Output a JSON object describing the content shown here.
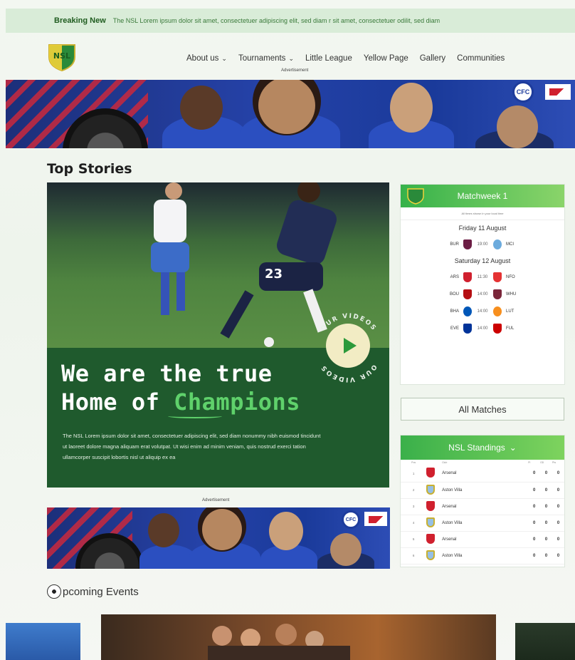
{
  "breaking": {
    "label": "Breaking New",
    "text": "The NSL Lorem ipsum dolor sit amet, consectetuer adipiscing elit, sed diam  r sit amet, consectetuer odilit, sed diam"
  },
  "header": {
    "logo_text": "NSL",
    "nav": [
      {
        "label": "About us",
        "dropdown": true
      },
      {
        "label": "Tournaments",
        "dropdown": true
      },
      {
        "label": "Little League",
        "dropdown": false
      },
      {
        "label": "Yellow Page",
        "dropdown": false
      },
      {
        "label": "Gallery",
        "dropdown": false
      },
      {
        "label": "Communities",
        "dropdown": false
      }
    ],
    "ad_label": "Advertisement"
  },
  "top_stories": {
    "title": "Top Stories",
    "hero": {
      "headline_line1": "We are the true",
      "headline_line2_prefix": "Home of ",
      "headline_accent": "Champions",
      "body": "The NSL Lorem ipsum dolor sit amet, consectetuer adipiscing elit, sed diam nonummy nibh euismod tincidunt ut laoreet dolore magna aliquam erat volutpat. Ut wisi enim ad minim veniam, quis nostrud exerci tation ullamcorper suscipit lobortis nisl ut aliquip ex ea",
      "ring_text_top": "OUR VIDEOS",
      "ring_text_bottom": "OUR VIDEOS",
      "jersey_number": "23"
    }
  },
  "matchweek": {
    "title": "Matchweek 1",
    "subbar": "All times shown in your local time",
    "days": [
      {
        "label": "Friday 11 August",
        "matches": [
          {
            "home": "BUR",
            "time": "19:00",
            "away": "MCI",
            "home_color": "#6c1d45",
            "away_color": "#6cabdd"
          }
        ]
      },
      {
        "label": "Saturday 12 August",
        "matches": [
          {
            "home": "ARS",
            "time": "11:30",
            "away": "NFO",
            "home_color": "#d0202e",
            "away_color": "#e53233"
          },
          {
            "home": "BOU",
            "time": "14:00",
            "away": "WHU",
            "home_color": "#b50e12",
            "away_color": "#7a263a"
          },
          {
            "home": "BHA",
            "time": "14:00",
            "away": "LUT",
            "home_color": "#0057b8",
            "away_color": "#f78f1e"
          },
          {
            "home": "EVE",
            "time": "14:00",
            "away": "FUL",
            "home_color": "#003399",
            "away_color": "#cc0000"
          }
        ]
      }
    ],
    "all_matches": "All Matches"
  },
  "standings": {
    "title": "NSL Standings",
    "headers": [
      "Pos",
      "Club",
      "Pl",
      "GD",
      "Pts"
    ],
    "rows": [
      {
        "pos": "1",
        "team": "Arsenal",
        "crest": "#d0202e",
        "pl": "0",
        "gd": "0",
        "pts": "0"
      },
      {
        "pos": "2",
        "team": "Aston Villa",
        "crest": "#95bfe5",
        "pl": "0",
        "gd": "0",
        "pts": "0"
      },
      {
        "pos": "3",
        "team": "Arsenal",
        "crest": "#d0202e",
        "pl": "0",
        "gd": "0",
        "pts": "0"
      },
      {
        "pos": "4",
        "team": "Aston Villa",
        "crest": "#95bfe5",
        "pl": "0",
        "gd": "0",
        "pts": "0"
      },
      {
        "pos": "5",
        "team": "Arsenal",
        "crest": "#d0202e",
        "pl": "0",
        "gd": "0",
        "pts": "0"
      },
      {
        "pos": "6",
        "team": "Aston Villa",
        "crest": "#95bfe5",
        "pl": "0",
        "gd": "0",
        "pts": "0"
      }
    ]
  },
  "ad_mid_label": "Advertisement",
  "events": {
    "title": "pcoming Events"
  },
  "colors": {
    "brand_green": "#1f5a2d",
    "accent_green": "#5fd16b",
    "header_green": "#36b24a",
    "breaking_bg": "#d9ecd8"
  }
}
